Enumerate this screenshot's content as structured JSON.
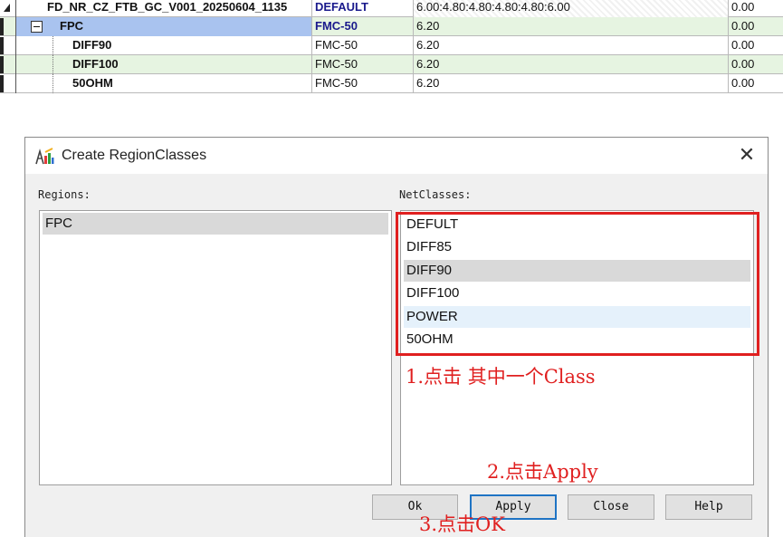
{
  "grid": {
    "rows": [
      {
        "name": "FD_NR_CZ_FTB_GC_V001_20250604_1135",
        "a": "DEFAULT",
        "b": "6.00:4.80:4.80:4.80:4.80:6.00",
        "c": "0.00"
      },
      {
        "name": "FPC",
        "a": "FMC-50",
        "b": "6.20",
        "c": "0.00"
      },
      {
        "name": "DIFF90",
        "a": "FMC-50",
        "b": "6.20",
        "c": "0.00"
      },
      {
        "name": "DIFF100",
        "a": "FMC-50",
        "b": "6.20",
        "c": "0.00"
      },
      {
        "name": "50OHM",
        "a": "FMC-50",
        "b": "6.20",
        "c": "0.00"
      }
    ]
  },
  "dialog": {
    "title": "Create RegionClasses",
    "close_glyph": "✕",
    "regions_label": "Regions:",
    "netclasses_label": "NetClasses:",
    "regions": [
      "FPC"
    ],
    "netclasses": [
      "DEFULT",
      "DIFF85",
      "DIFF90",
      "DIFF100",
      "POWER",
      "50OHM"
    ],
    "selected_region": "FPC",
    "selected_netclass": "DIFF90",
    "hovered_netclass": "POWER",
    "buttons": {
      "ok": "Ok",
      "apply": "Apply",
      "close": "Close",
      "help": "Help"
    }
  },
  "annotations": {
    "step1": "1.点击 其中一个Class",
    "step2": "2.点击Apply",
    "step3": "3.点击OK",
    "color": "#e02020"
  }
}
